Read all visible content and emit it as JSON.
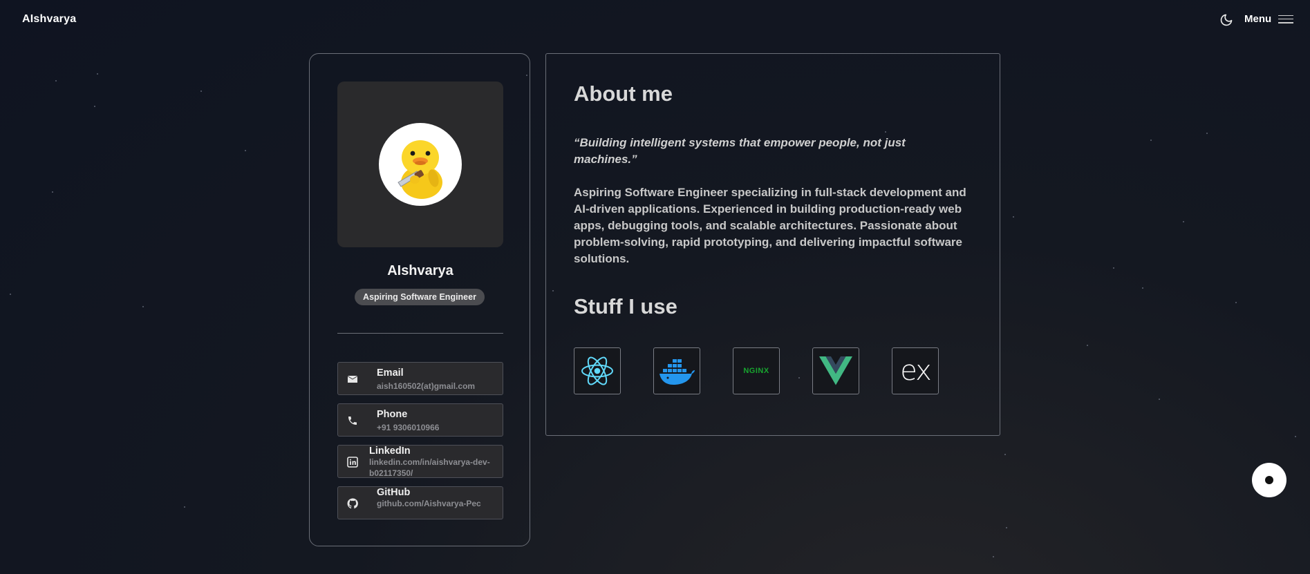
{
  "nav": {
    "brand": "AIshvarya",
    "menu_label": "Menu",
    "theme_icon": "moon-icon",
    "menu_icon": "hamburger-icon"
  },
  "profile": {
    "name": "AIshvarya",
    "role": "Aspiring Software Engineer",
    "contacts": [
      {
        "label": "Email",
        "value": "aish160502(at)gmail.com",
        "icon": "mail-icon"
      },
      {
        "label": "Phone",
        "value": "+91 9306010966",
        "icon": "phone-icon"
      },
      {
        "label": "LinkedIn",
        "value": "linkedin.com/in/aishvarya-dev-b02117350/",
        "icon": "linkedin-icon"
      },
      {
        "label": "GitHub",
        "value": "github.com/Aishvarya-Pec",
        "icon": "github-icon"
      }
    ]
  },
  "about": {
    "heading": "About me",
    "quote": "“Building intelligent systems that empower people, not just machines.”",
    "bio": "Aspiring Software Engineer specializing in full-stack development and AI-driven applications. Experienced in building production-ready web apps, debugging tools, and scalable architectures. Passionate about problem-solving, rapid prototyping, and delivering impactful software solutions."
  },
  "stack": {
    "heading": "Stuff I use",
    "tools": [
      {
        "icon": "react-icon"
      },
      {
        "icon": "docker-icon"
      },
      {
        "icon": "nginx-icon",
        "text": "NGINX"
      },
      {
        "icon": "vue-icon"
      },
      {
        "icon": "express-icon",
        "text": "ex"
      }
    ]
  },
  "colors": {
    "background": "#0f1421",
    "card_border": "#6b6f78",
    "react": "#61dafb",
    "docker": "#2496ed",
    "nginx": "#17a62f",
    "vue_green": "#41b883",
    "vue_dark": "#34495e"
  }
}
